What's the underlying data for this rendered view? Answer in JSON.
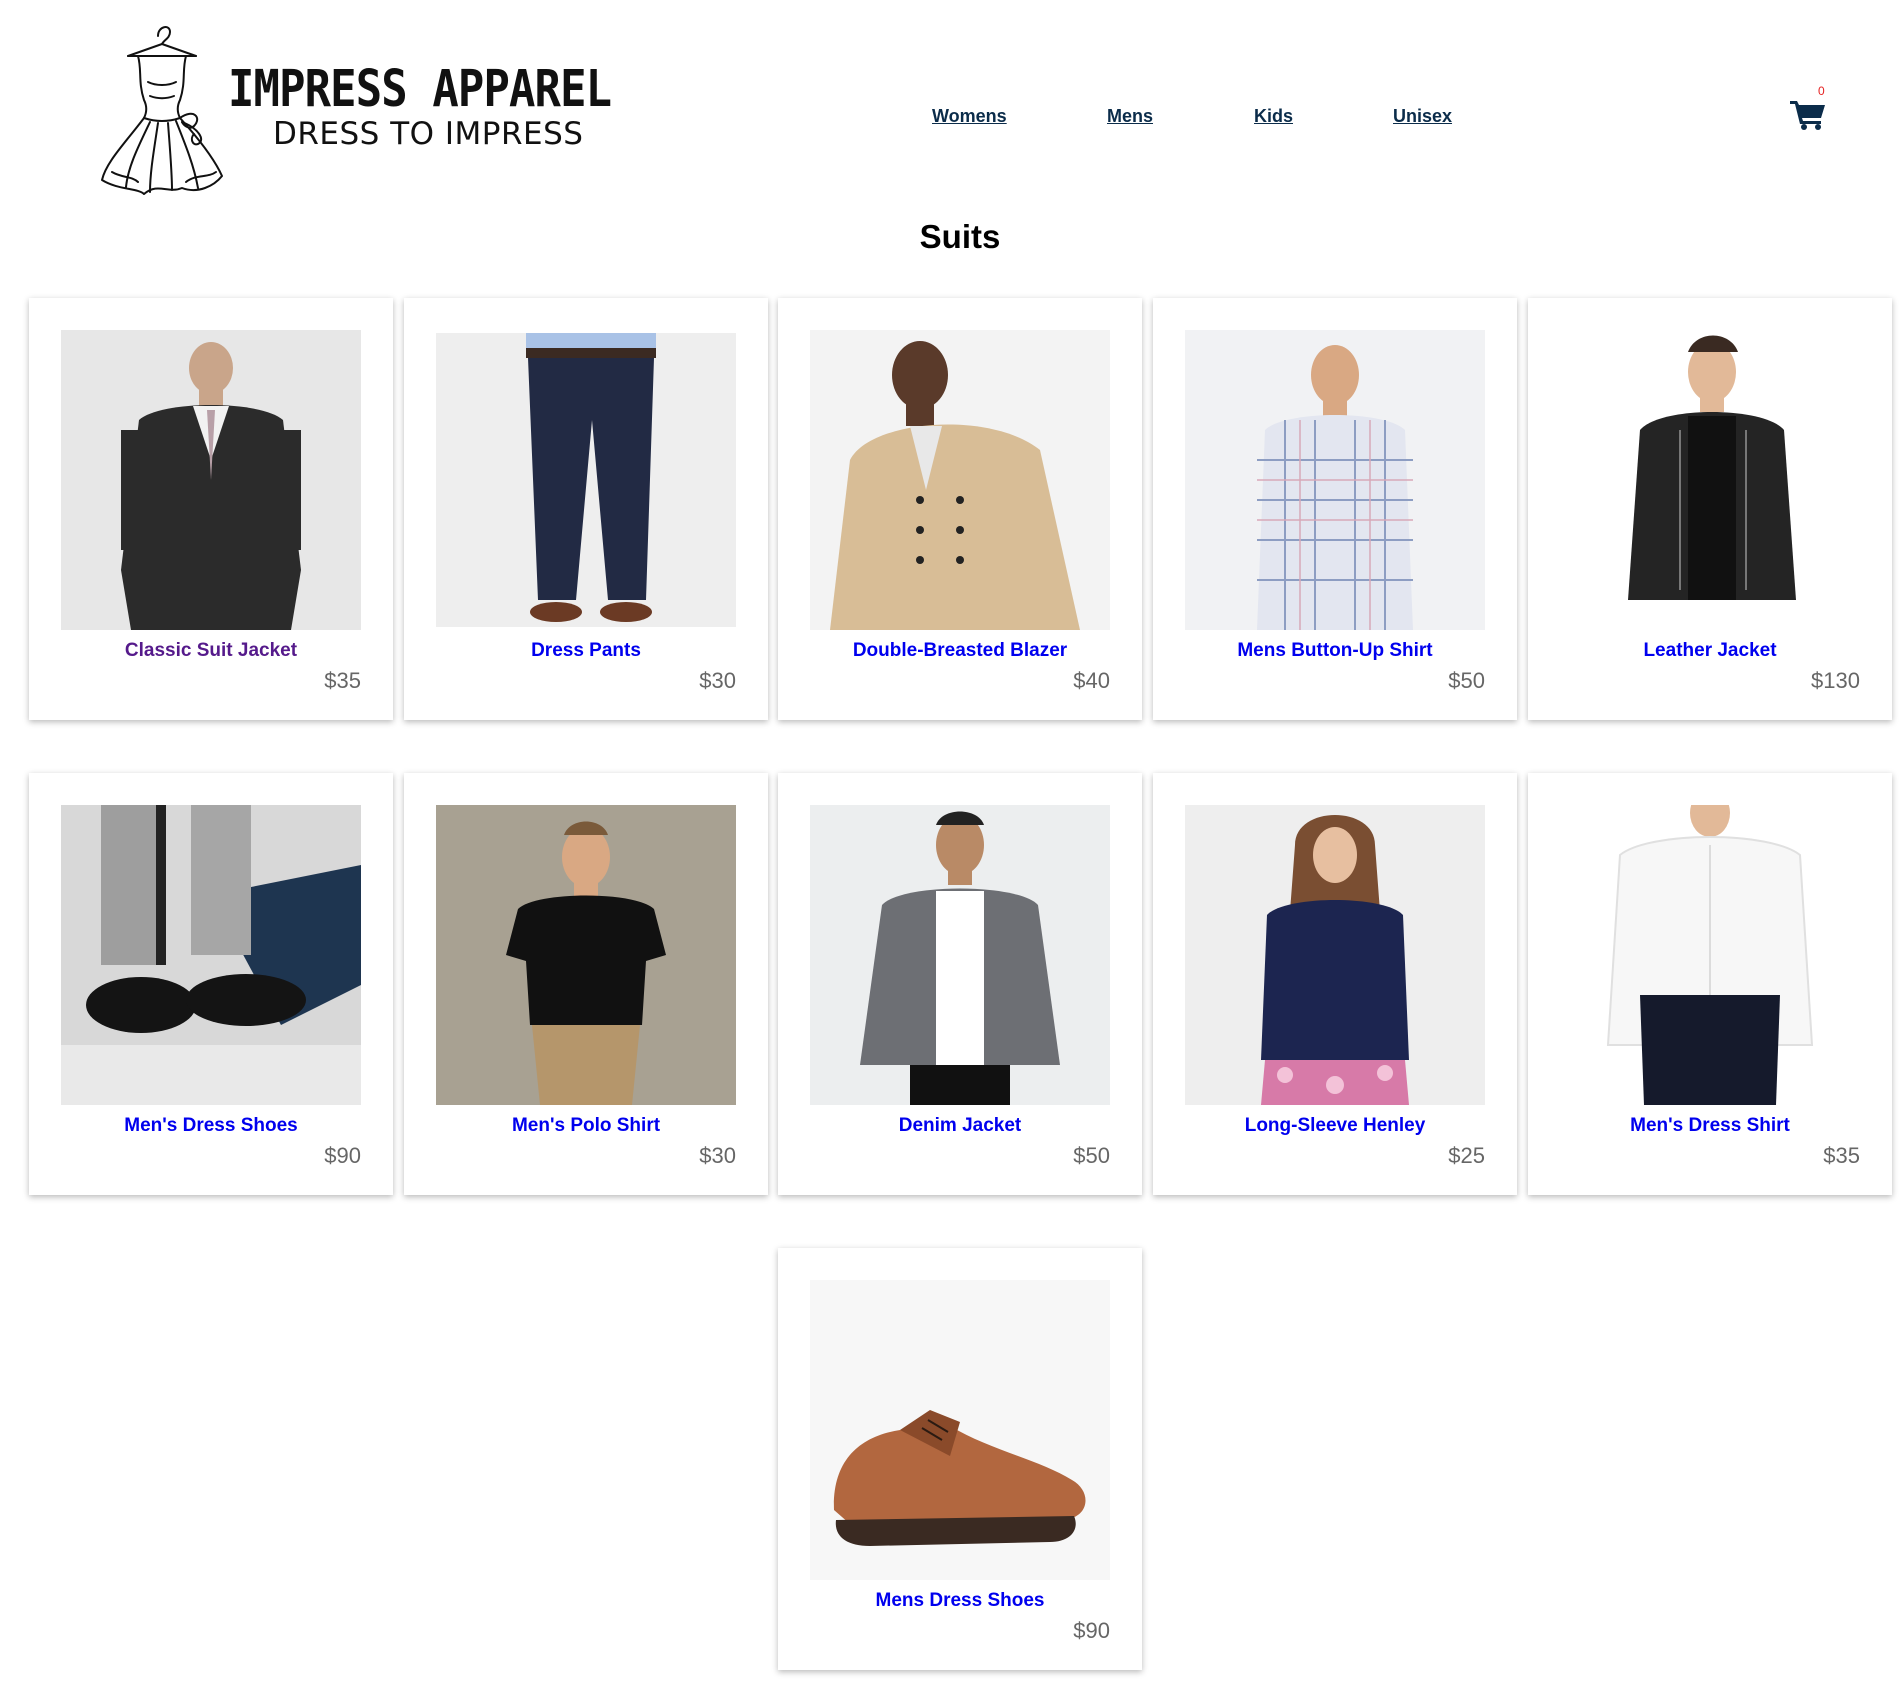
{
  "brand": {
    "name": "IMPRESS APPAREL",
    "tagline": "DRESS TO IMPRESS"
  },
  "nav": {
    "items": [
      "Womens",
      "Mens",
      "Kids",
      "Unisex"
    ]
  },
  "cart": {
    "count": "0",
    "icon": "shopping-cart-icon"
  },
  "page": {
    "title": "Suits"
  },
  "colors": {
    "link": "#0000ee",
    "visited_link": "#551a8b",
    "nav_link": "#0b2c4a",
    "price": "#666666",
    "cart_icon": "#0b2c4a",
    "cart_badge": "#e52222"
  },
  "products": [
    {
      "name": "Classic Suit Jacket",
      "price": "$35",
      "image": "dark suit jacket photo"
    },
    {
      "name": "Dress Pants",
      "price": "$30",
      "image": "navy dress pants photo"
    },
    {
      "name": "Double-Breasted Blazer",
      "price": "$40",
      "image": "beige double-breasted blazer photo"
    },
    {
      "name": "Mens Button-Up Shirt",
      "price": "$50",
      "image": "plaid button-up shirt photo"
    },
    {
      "name": "Leather Jacket",
      "price": "$130",
      "image": "black leather jacket photo"
    },
    {
      "name": "Men's Dress Shoes",
      "price": "$90",
      "image": "black tassel loafers photo"
    },
    {
      "name": "Men's Polo Shirt",
      "price": "$30",
      "image": "black polo shirt photo"
    },
    {
      "name": "Denim Jacket",
      "price": "$50",
      "image": "grey denim jacket photo"
    },
    {
      "name": "Long-Sleeve Henley",
      "price": "$25",
      "image": "navy long-sleeve henley photo"
    },
    {
      "name": "Men's Dress Shirt",
      "price": "$35",
      "image": "white dress shirt photo"
    },
    {
      "name": "Mens Dress Shoes",
      "price": "$90",
      "image": "brown derby shoe photo"
    }
  ]
}
